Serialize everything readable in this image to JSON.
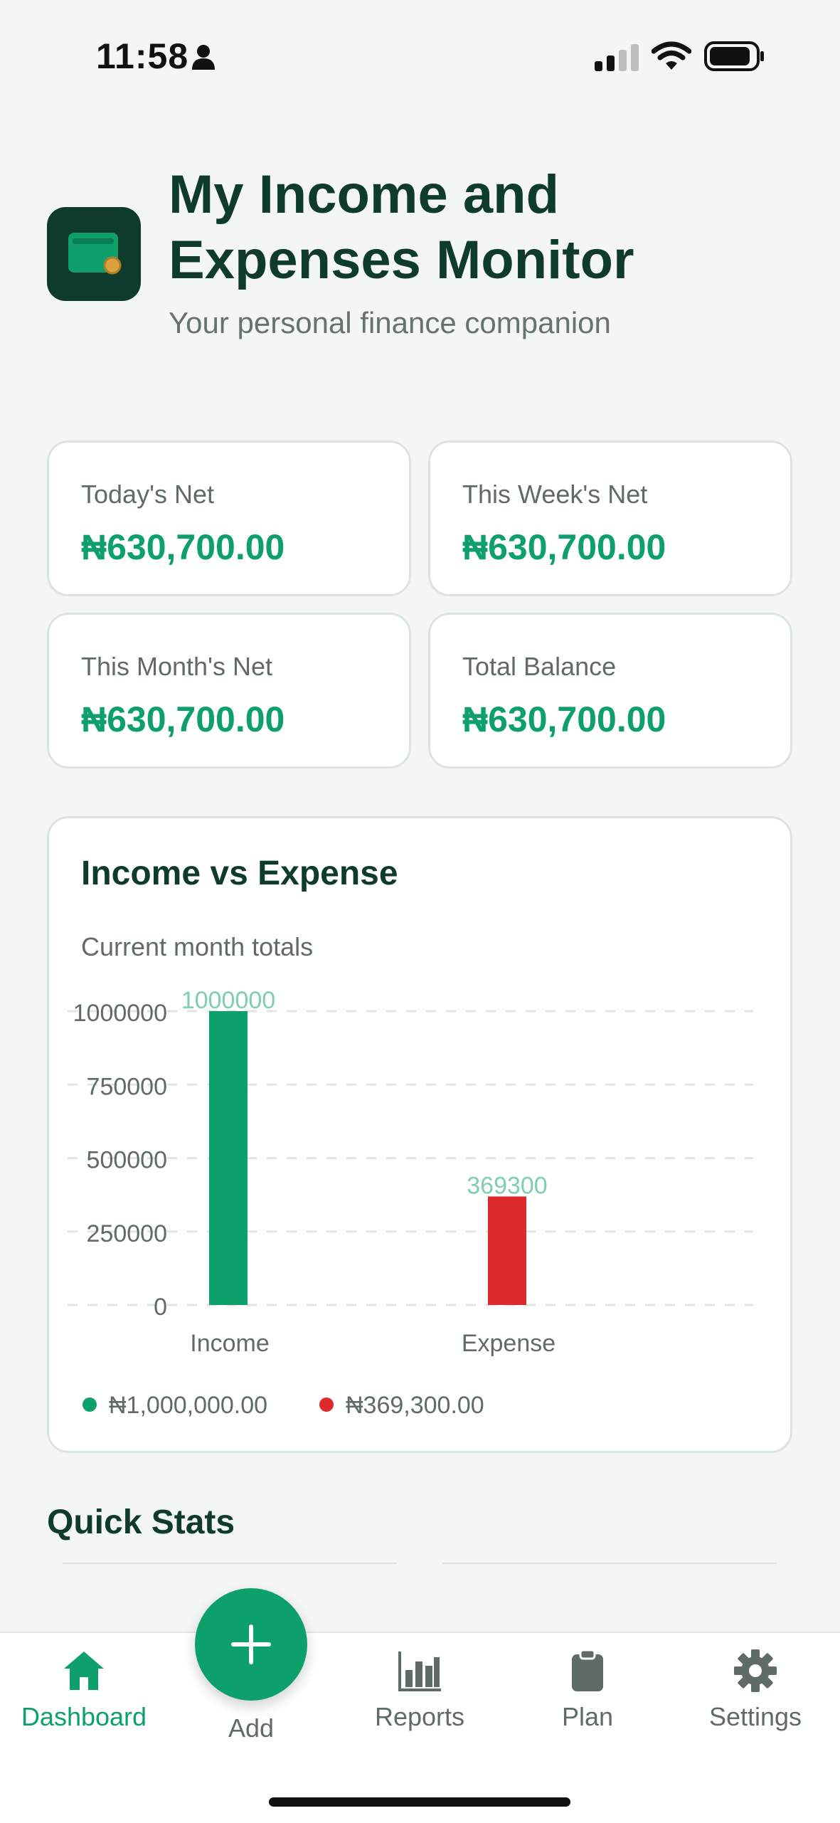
{
  "status_bar": {
    "time": "11:58"
  },
  "header": {
    "title": "My Income and Expenses Monitor",
    "subtitle": "Your personal finance companion"
  },
  "stats": [
    {
      "label": "Today's Net",
      "value": "₦630,700.00"
    },
    {
      "label": "This Week's Net",
      "value": "₦630,700.00"
    },
    {
      "label": "This Month's Net",
      "value": "₦630,700.00"
    },
    {
      "label": "Total Balance",
      "value": "₦630,700.00"
    }
  ],
  "chart": {
    "title": "Income vs Expense",
    "subtitle": "Current month totals",
    "legend": [
      {
        "label": "₦1,000,000.00",
        "color": "#0ea06a"
      },
      {
        "label": "₦369,300.00",
        "color": "#dd2a2a"
      }
    ]
  },
  "chart_data": {
    "type": "bar",
    "categories": [
      "Income",
      "Expense"
    ],
    "values": [
      1000000,
      369300
    ],
    "value_labels": [
      "1000000",
      "369300"
    ],
    "colors": [
      "#0ea06a",
      "#dd2a2a"
    ],
    "yticks": [
      0,
      250000,
      500000,
      750000,
      1000000
    ],
    "ytick_labels": [
      "0",
      "250000",
      "500000",
      "750000",
      "1000000"
    ],
    "ylim": [
      0,
      1000000
    ],
    "grid": true
  },
  "quick_stats": {
    "title": "Quick Stats"
  },
  "nav": {
    "items": [
      {
        "label": "Dashboard",
        "icon": "home-icon",
        "active": true
      },
      {
        "label": "Reports",
        "icon": "bar-chart-icon"
      },
      {
        "label": "Plan",
        "icon": "clipboard-icon"
      },
      {
        "label": "Settings",
        "icon": "gear-icon"
      }
    ],
    "fab_label": "Add"
  },
  "colors": {
    "accent": "#0ea06a",
    "expense": "#dd2a2a",
    "dark": "#0f3b2c"
  }
}
